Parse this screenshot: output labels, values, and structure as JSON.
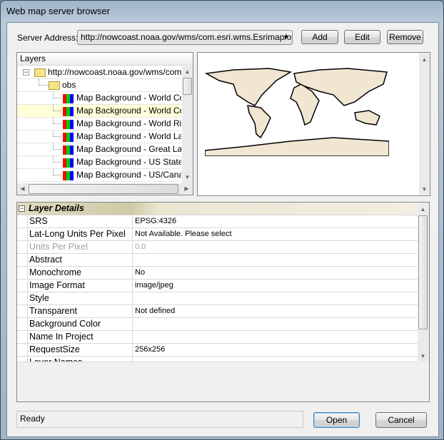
{
  "window": {
    "title": "Web map server browser"
  },
  "server": {
    "label": "Server Address:",
    "value": "http://nowcoast.noaa.gov/wms/com.esri.wms.Esrimap/obs",
    "add": "Add",
    "edit": "Edit",
    "remove": "Remove"
  },
  "tree": {
    "header": "Layers",
    "root": "http://nowcoast.noaa.gov/wms/com.esri.wms.Esrimap/obs",
    "folder": "obs",
    "layers": [
      "Map Background - World Countries",
      "Map Background - World Countries",
      "Map Background - World Rivers",
      "Map Background - World Lakes",
      "Map Background - Great Lakes",
      "Map Background - US States -",
      "Map Background - US/Canada"
    ],
    "selected_index": 1
  },
  "details": {
    "category": "Layer Details",
    "rows": [
      {
        "label": "SRS",
        "value": "EPSG:4326"
      },
      {
        "label": "Lat-Long Units Per Pixel",
        "value": "Not Available. Please select"
      },
      {
        "label": "Units Per Pixel",
        "value": "0.0",
        "disabled": true
      },
      {
        "label": "Abstract",
        "value": ""
      },
      {
        "label": "Monochrome",
        "value": "No"
      },
      {
        "label": "Image Format",
        "value": "image/jpeg"
      },
      {
        "label": "Style",
        "value": ""
      },
      {
        "label": "Transparent",
        "value": "Not defined"
      },
      {
        "label": "Background Color",
        "value": ""
      },
      {
        "label": "Name In Project",
        "value": ""
      },
      {
        "label": "RequestSize",
        "value": "256x256"
      },
      {
        "label": "Layer Names",
        "value": ""
      }
    ]
  },
  "status": "Ready",
  "buttons": {
    "open": "Open",
    "cancel": "Cancel"
  },
  "colors": {
    "land": "#f0e6d2",
    "selected_row": "#ffffd8"
  }
}
